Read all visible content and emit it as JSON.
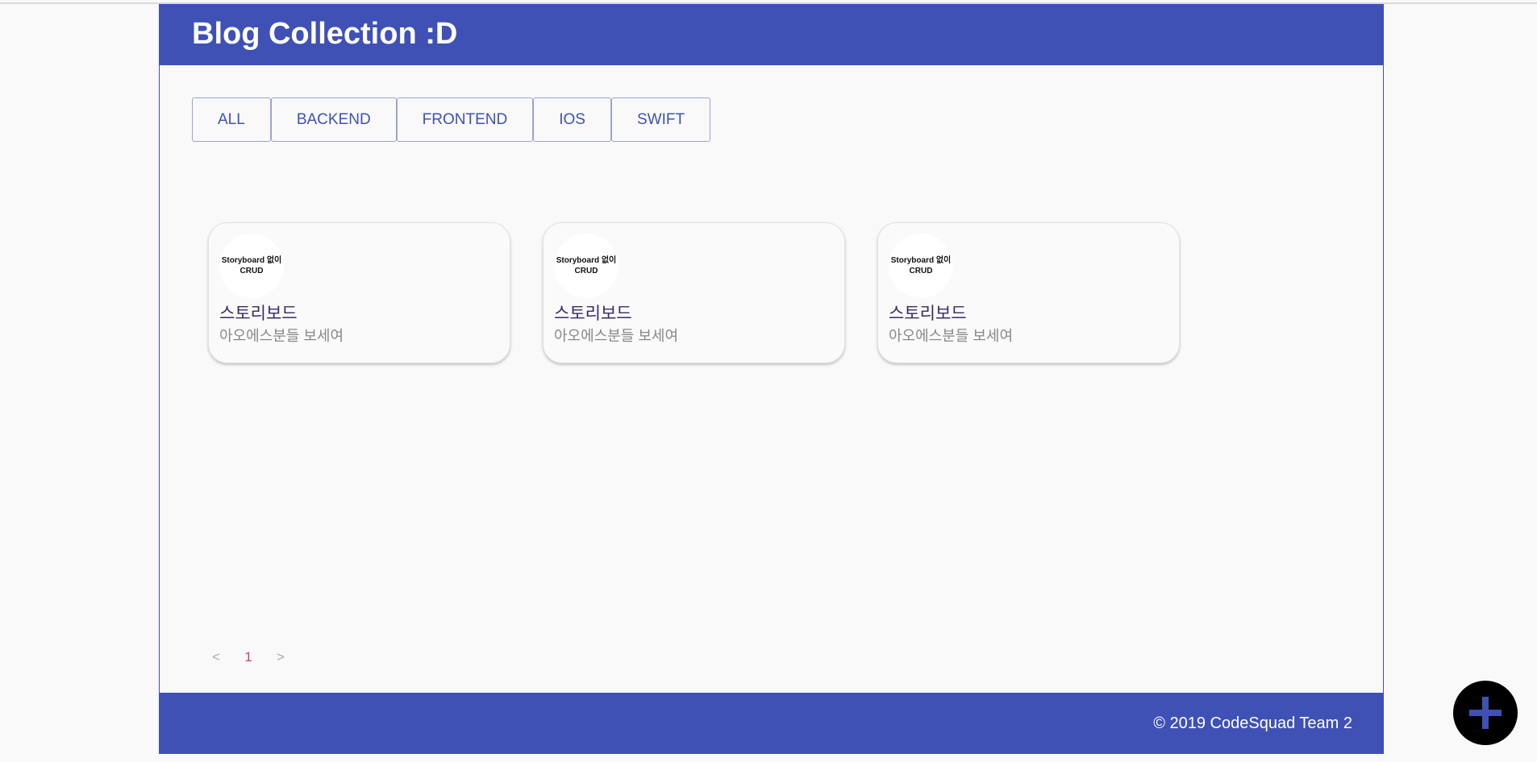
{
  "header": {
    "title": "Blog Collection :D"
  },
  "filters": [
    {
      "label": "ALL"
    },
    {
      "label": "BACKEND"
    },
    {
      "label": "FRONTEND"
    },
    {
      "label": "IOS"
    },
    {
      "label": "SWIFT"
    }
  ],
  "cards": [
    {
      "thumb_line1": "Storyboard 없이",
      "thumb_line2": "CRUD",
      "title": "스토리보드",
      "description": "아오에스분들 보세여"
    },
    {
      "thumb_line1": "Storyboard 없이",
      "thumb_line2": "CRUD",
      "title": "스토리보드",
      "description": "아오에스분들 보세여"
    },
    {
      "thumb_line1": "Storyboard 없이",
      "thumb_line2": "CRUD",
      "title": "스토리보드",
      "description": "아오에스분들 보세여"
    }
  ],
  "pagination": {
    "prev": "<",
    "current": "1",
    "next": ">"
  },
  "footer": {
    "copyright": "© 2019 CodeSquad Team 2"
  },
  "fab": {
    "icon": "plus-icon"
  },
  "colors": {
    "primary": "#3f51b5",
    "background": "#f9f9f9",
    "current_page": "#e53960",
    "fab": "#000000"
  }
}
